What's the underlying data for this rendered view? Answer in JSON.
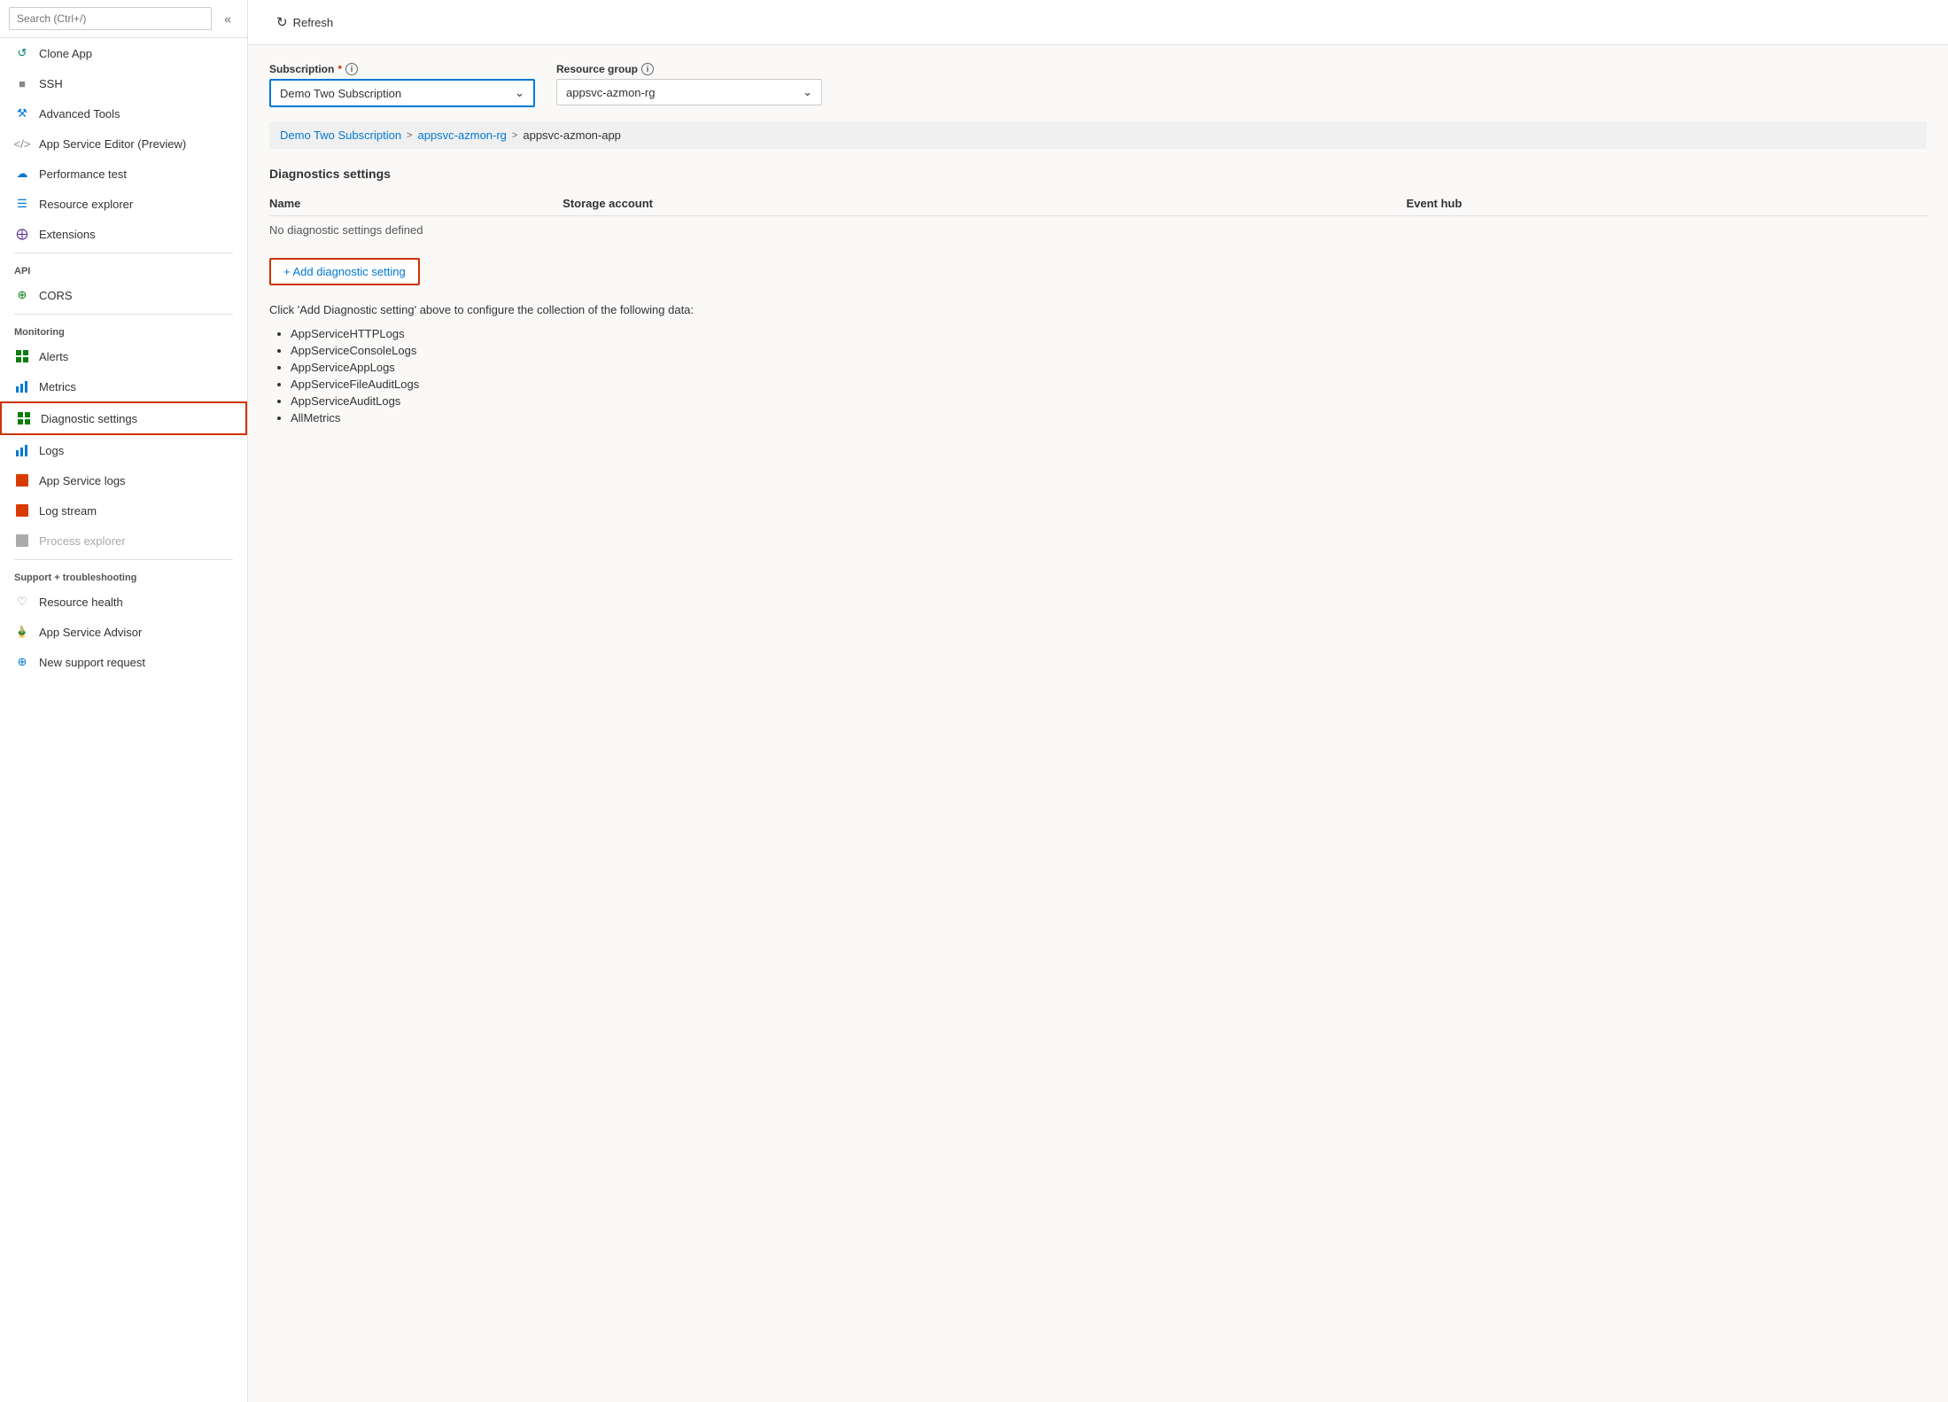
{
  "sidebar": {
    "search_placeholder": "Search (Ctrl+/)",
    "items": [
      {
        "id": "clone-app",
        "label": "Clone App",
        "icon": "🔁",
        "icon_class": "icon-teal",
        "disabled": false
      },
      {
        "id": "ssh",
        "label": "SSH",
        "icon": "⬛",
        "icon_class": "icon-gray",
        "disabled": false
      },
      {
        "id": "advanced-tools",
        "label": "Advanced Tools",
        "icon": "🔧",
        "icon_class": "icon-blue",
        "disabled": false
      },
      {
        "id": "app-service-editor",
        "label": "App Service Editor (Preview)",
        "icon": "</>",
        "icon_class": "icon-gray",
        "disabled": false
      },
      {
        "id": "performance-test",
        "label": "Performance test",
        "icon": "☁",
        "icon_class": "icon-blue",
        "disabled": false
      },
      {
        "id": "resource-explorer",
        "label": "Resource explorer",
        "icon": "≡",
        "icon_class": "icon-blue",
        "disabled": false
      },
      {
        "id": "extensions",
        "label": "Extensions",
        "icon": "⊞",
        "icon_class": "icon-purple",
        "disabled": false
      }
    ],
    "sections": [
      {
        "label": "API",
        "items": [
          {
            "id": "cors",
            "label": "CORS",
            "icon": "⊕",
            "icon_class": "icon-green",
            "disabled": false
          }
        ]
      },
      {
        "label": "Monitoring",
        "items": [
          {
            "id": "alerts",
            "label": "Alerts",
            "icon": "▦",
            "icon_class": "icon-green",
            "disabled": false
          },
          {
            "id": "metrics",
            "label": "Metrics",
            "icon": "📊",
            "icon_class": "icon-blue",
            "disabled": false
          },
          {
            "id": "diagnostic-settings",
            "label": "Diagnostic settings",
            "icon": "▦",
            "icon_class": "icon-green",
            "active": true,
            "disabled": false
          },
          {
            "id": "logs",
            "label": "Logs",
            "icon": "📊",
            "icon_class": "icon-blue",
            "disabled": false
          },
          {
            "id": "app-service-logs",
            "label": "App Service logs",
            "icon": "🟧",
            "icon_class": "icon-orange",
            "disabled": false
          },
          {
            "id": "log-stream",
            "label": "Log stream",
            "icon": "🟧",
            "icon_class": "icon-orange",
            "disabled": false
          },
          {
            "id": "process-explorer",
            "label": "Process explorer",
            "icon": "⬛",
            "icon_class": "icon-gray",
            "disabled": true
          }
        ]
      },
      {
        "label": "Support + troubleshooting",
        "items": [
          {
            "id": "resource-health",
            "label": "Resource health",
            "icon": "♡",
            "icon_class": "icon-gray",
            "disabled": false
          },
          {
            "id": "app-service-advisor",
            "label": "App Service Advisor",
            "icon": "🏅",
            "icon_class": "icon-blue",
            "disabled": false
          },
          {
            "id": "new-support-request",
            "label": "New support request",
            "icon": "⊕",
            "icon_class": "icon-blue",
            "disabled": false
          }
        ]
      }
    ]
  },
  "toolbar": {
    "refresh_label": "Refresh"
  },
  "form": {
    "subscription_label": "Subscription",
    "subscription_required": "*",
    "subscription_value": "Demo Two Subscription",
    "resource_group_label": "Resource group",
    "resource_group_value": "appsvc-azmon-rg"
  },
  "breadcrumb": {
    "parts": [
      {
        "label": "Demo Two Subscription",
        "link": true
      },
      {
        "label": "appsvc-azmon-rg",
        "link": true
      },
      {
        "label": "appsvc-azmon-app",
        "link": false
      }
    ]
  },
  "diagnostics": {
    "section_title": "Diagnostics settings",
    "columns": [
      "Name",
      "Storage account",
      "Event hub"
    ],
    "no_settings_text": "No diagnostic settings defined",
    "add_button_label": "+ Add diagnostic setting",
    "info_text": "Click 'Add Diagnostic setting' above to configure the collection of the following data:",
    "data_types": [
      "AppServiceHTTPLogs",
      "AppServiceConsoleLogs",
      "AppServiceAppLogs",
      "AppServiceFileAuditLogs",
      "AppServiceAuditLogs",
      "AllMetrics"
    ]
  }
}
